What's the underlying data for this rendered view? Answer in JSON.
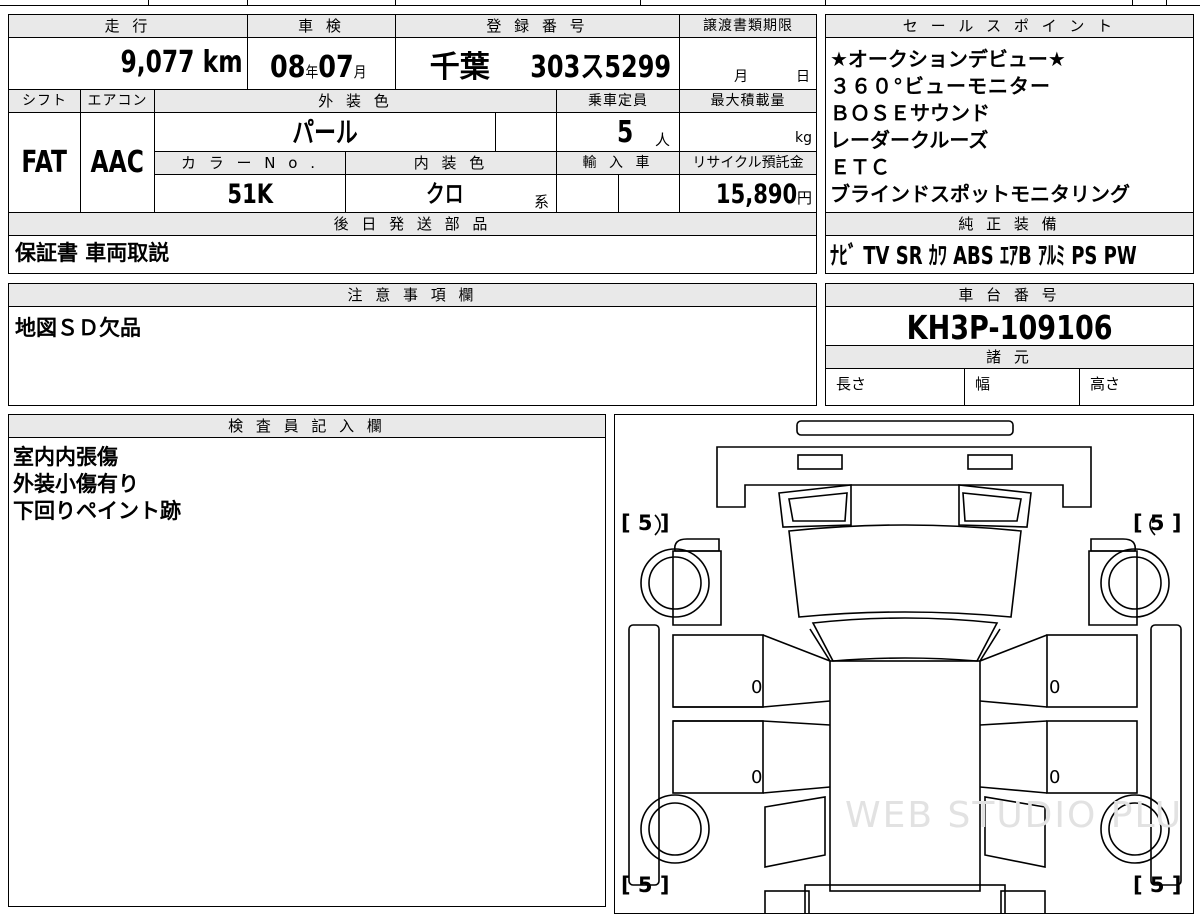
{
  "top_header": {
    "mileage_label": "走 行",
    "inspection_label": "車 検",
    "registration_label": "登 録 番 号",
    "transfer_deadline_label": "譲渡書類期限"
  },
  "top_values": {
    "mileage": "9,077",
    "mileage_unit": "km",
    "inspection_year": "08",
    "year_unit": "年",
    "inspection_month": "07",
    "month_unit": "月",
    "plate_region": "千葉",
    "plate_number": "303ス5299",
    "deadline_month_unit": "月",
    "deadline_day_unit": "日"
  },
  "row2_header": {
    "shift_label": "シフト",
    "aircon_label": "エアコン",
    "exterior_color_label": "外 装 色",
    "capacity_label": "乗車定員",
    "max_load_label": "最大積載量"
  },
  "row2_values": {
    "shift": "FAT",
    "aircon": "AAC",
    "exterior_color": "パール",
    "capacity": "5",
    "capacity_unit": "人",
    "load_unit": "kg"
  },
  "row3_header": {
    "color_no_label": "カ ラ ー N o .",
    "interior_color_label": "内 装 色",
    "import_label": "輸 入 車",
    "recycle_label": "リサイクル預託金"
  },
  "row3_values": {
    "color_no": "51K",
    "interior_color": "クロ",
    "interior_suffix": "系",
    "recycle_fee": "15,890",
    "recycle_unit": "円"
  },
  "parts_section": {
    "label": "後 日 発 送 部 品",
    "text": "保証書 車両取説"
  },
  "sales_points": {
    "label": "セ ー ル ス ポ イ ン ト",
    "items": [
      "★オークションデビュー★",
      "３６０°ビューモニター",
      "ＢＯＳＥサウンド",
      "レーダークルーズ",
      "ＥＴＣ",
      "ブラインドスポットモニタリング"
    ]
  },
  "standard_equipment": {
    "label": "純 正 装 備",
    "text": "ﾅﾋﾞ TV SR ｶﾜ ABS ｴｱB ｱﾙﾐ PS PW"
  },
  "notes_section": {
    "label": "注 意 事 項 欄",
    "text": "地図ＳＤ欠品"
  },
  "chassis": {
    "label": "車 台 番 号",
    "number": "KH3P-109106"
  },
  "specs": {
    "label": "諸 元",
    "length_label": "長さ",
    "width_label": "幅",
    "height_label": "高さ"
  },
  "inspector": {
    "label": "検 査 員 記 入 欄",
    "lines": [
      "室内内張傷",
      "外装小傷有り",
      "下回りペイント跡"
    ]
  },
  "diagram": {
    "tire_ratings": [
      "[ 5 ]",
      "[ 5 ]",
      "[ 5 ]",
      "[ 5 ]"
    ],
    "door_marks": [
      "0",
      "0",
      "0",
      "0"
    ],
    "watermark": "WEB STUDIO PLU"
  }
}
